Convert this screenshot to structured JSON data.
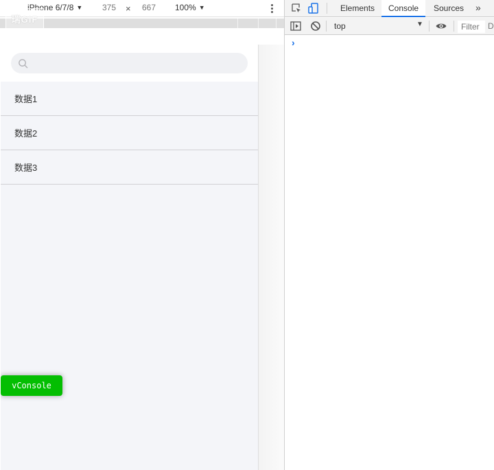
{
  "emulation": {
    "device": "iPhone 6/7/8",
    "width": "375",
    "times": "×",
    "height": "667",
    "zoom": "100%",
    "logo_text": "瑞GIF"
  },
  "app": {
    "search": {
      "placeholder": "",
      "value": ""
    },
    "list_items": [
      "数据1",
      "数据2",
      "数据3"
    ],
    "vconsole_label": "vConsole",
    "colors": {
      "vconsole": "#04be02",
      "page_bg": "#f4f5f9"
    }
  },
  "devtools": {
    "tabs": [
      {
        "label": "Elements",
        "active": false
      },
      {
        "label": "Console",
        "active": true
      },
      {
        "label": "Sources",
        "active": false
      }
    ],
    "more": "»",
    "context": "top",
    "filter_placeholder": "Filter",
    "filter_cut": "D",
    "prompt": "›",
    "colors": {
      "active_tab": "#1a73e8"
    }
  }
}
